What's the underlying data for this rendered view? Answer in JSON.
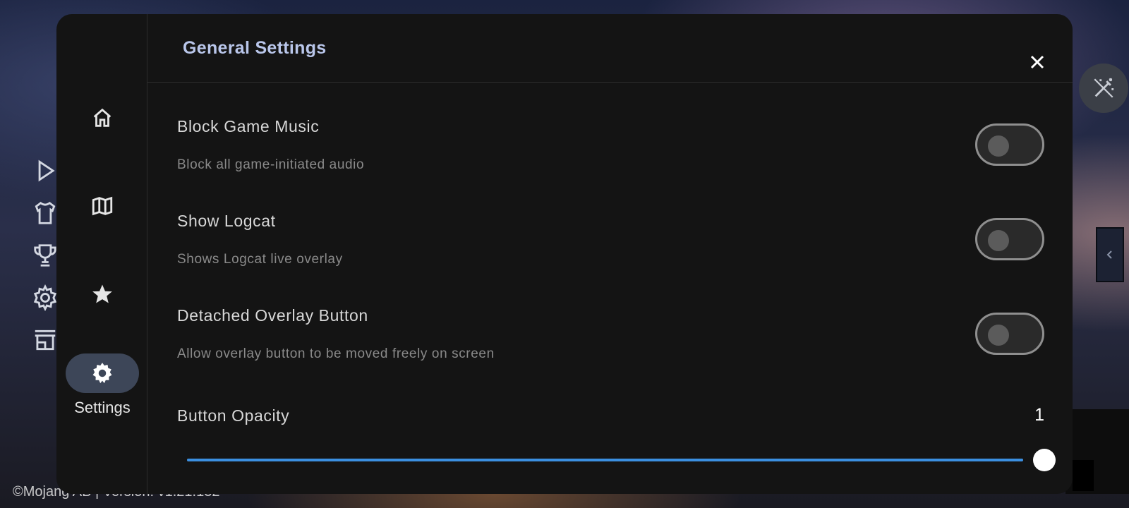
{
  "background": {
    "footer_text": "©Mojang AB | Version: v1.21.132",
    "rail_icons": [
      "play-icon",
      "shirt-icon",
      "trophy-icon",
      "gear-icon",
      "store-icon"
    ]
  },
  "nav": {
    "items": [
      {
        "icon": "home-icon",
        "label": ""
      },
      {
        "icon": "map-icon",
        "label": ""
      },
      {
        "icon": "star-icon",
        "label": ""
      },
      {
        "icon": "settings-gear-icon",
        "label": "Settings",
        "active": true
      }
    ]
  },
  "dialog": {
    "title": "General Settings",
    "close_icon": "close-icon"
  },
  "settings": [
    {
      "title": "Block Game Music",
      "description": "Block all game-initiated audio",
      "enabled": false
    },
    {
      "title": "Show Logcat",
      "description": "Shows Logcat live overlay",
      "enabled": false
    },
    {
      "title": "Detached Overlay Button",
      "description": "Allow overlay button to be moved freely on screen",
      "enabled": false
    }
  ],
  "opacity": {
    "title": "Button Opacity",
    "value_text": "1",
    "value": 1.0
  },
  "colors": {
    "accent": "#3b8fe0",
    "title": "#b9c6ea",
    "active_nav": "#3d4658"
  }
}
